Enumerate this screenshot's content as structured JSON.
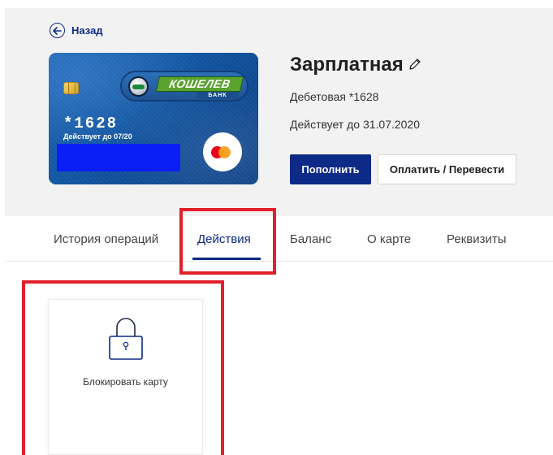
{
  "header": {
    "back_label": "Назад"
  },
  "card": {
    "brand": "КОШЕЛЕВ",
    "bank": "БАНК",
    "number_short": "*1628",
    "valid_to": "Действует до 07/20",
    "title": "Зарплатная",
    "type_line": "Дебетовая *1628",
    "expiry_line": "Действует до 31.07.2020"
  },
  "actions": {
    "topup_label": "Пополнить",
    "pay_label": "Оплатить / Перевести"
  },
  "tabs": [
    {
      "label": "История операций",
      "active": false
    },
    {
      "label": "Действия",
      "active": true
    },
    {
      "label": "Баланс",
      "active": false
    },
    {
      "label": "О карте",
      "active": false
    },
    {
      "label": "Реквизиты",
      "active": false
    }
  ],
  "tiles": [
    {
      "label": "Блокировать карту",
      "icon": "lock-icon"
    }
  ],
  "colors": {
    "accent": "#0d2a86",
    "highlight": "#e0202a",
    "header_bg": "#f2f2f2"
  }
}
